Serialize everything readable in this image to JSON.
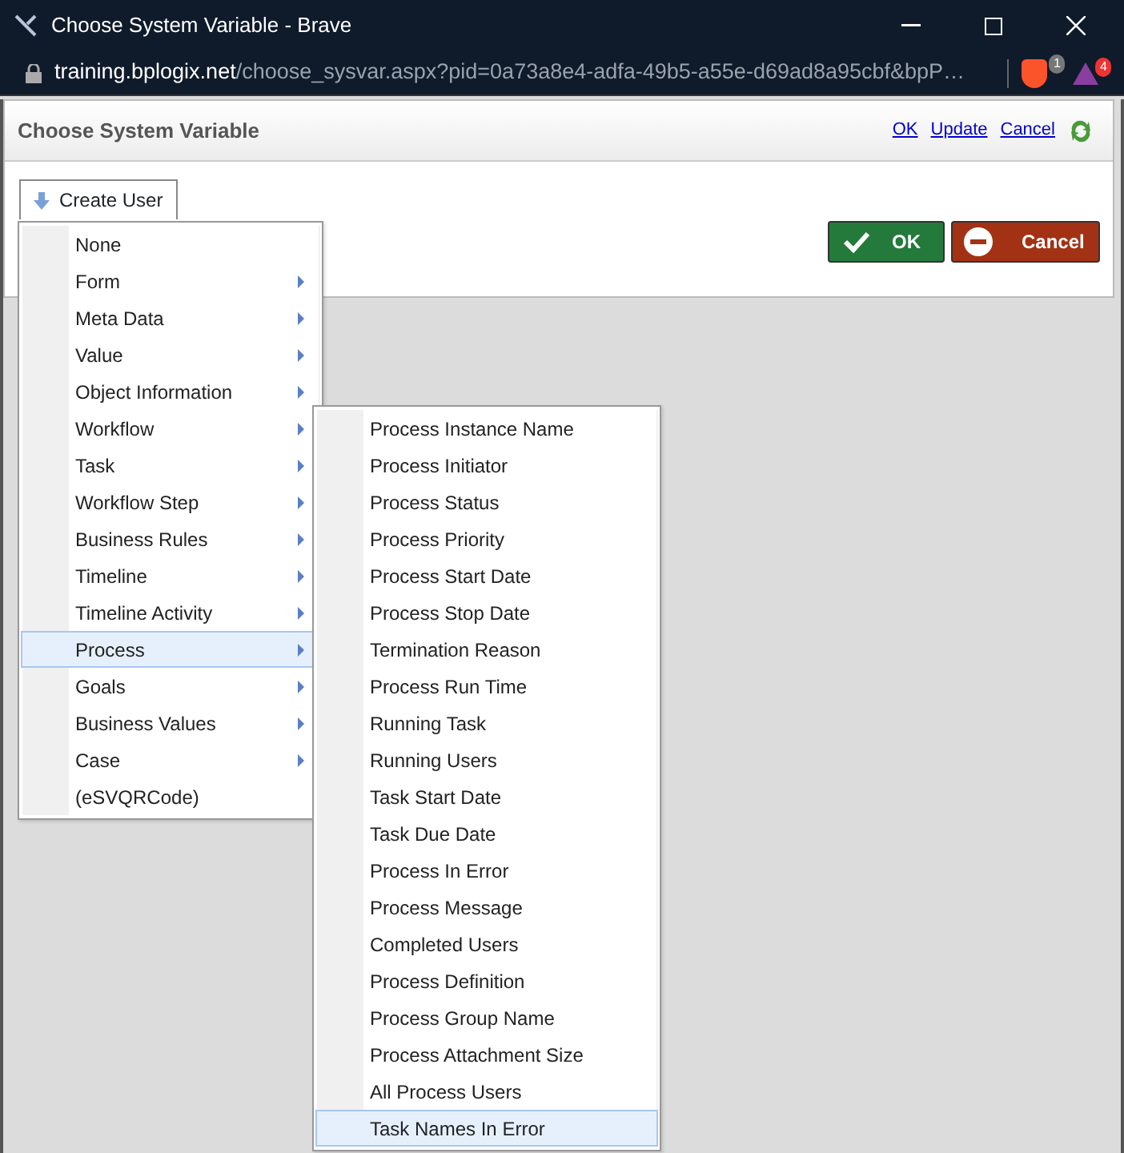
{
  "window": {
    "title": "Choose System Variable - Brave"
  },
  "address": {
    "host": "training.bplogix.net",
    "path": "/choose_sysvar.aspx?pid=0a73a8e4-adfa-49b5-a55e-d69ad8a95cbf&bpP…"
  },
  "extension_badges": [
    "1",
    "4"
  ],
  "panel": {
    "title": "Choose System Variable",
    "links": [
      "OK",
      "Update",
      "Cancel"
    ]
  },
  "dropdown": {
    "label": "Create User"
  },
  "buttons": [
    {
      "label": "OK",
      "kind": "ok"
    },
    {
      "label": "Cancel",
      "kind": "cancel"
    }
  ],
  "menu": [
    {
      "label": "None",
      "submenu": false,
      "selected": false
    },
    {
      "label": "Form",
      "submenu": true,
      "selected": false
    },
    {
      "label": "Meta Data",
      "submenu": true,
      "selected": false
    },
    {
      "label": "Value",
      "submenu": true,
      "selected": false
    },
    {
      "label": "Object Information",
      "submenu": true,
      "selected": false
    },
    {
      "label": "Workflow",
      "submenu": true,
      "selected": false
    },
    {
      "label": "Task",
      "submenu": true,
      "selected": false
    },
    {
      "label": "Workflow Step",
      "submenu": true,
      "selected": false
    },
    {
      "label": "Business Rules",
      "submenu": true,
      "selected": false
    },
    {
      "label": "Timeline",
      "submenu": true,
      "selected": false
    },
    {
      "label": "Timeline Activity",
      "submenu": true,
      "selected": false
    },
    {
      "label": "Process",
      "submenu": true,
      "selected": true
    },
    {
      "label": "Goals",
      "submenu": true,
      "selected": false
    },
    {
      "label": "Business Values",
      "submenu": true,
      "selected": false
    },
    {
      "label": "Case",
      "submenu": true,
      "selected": false
    },
    {
      "label": "(eSVQRCode)",
      "submenu": false,
      "selected": false
    }
  ],
  "submenu": [
    {
      "label": "Process Instance Name",
      "selected": false
    },
    {
      "label": "Process Initiator",
      "selected": false
    },
    {
      "label": "Process Status",
      "selected": false
    },
    {
      "label": "Process Priority",
      "selected": false
    },
    {
      "label": "Process Start Date",
      "selected": false
    },
    {
      "label": "Process Stop Date",
      "selected": false
    },
    {
      "label": "Termination Reason",
      "selected": false
    },
    {
      "label": "Process Run Time",
      "selected": false
    },
    {
      "label": "Running Task",
      "selected": false
    },
    {
      "label": "Running Users",
      "selected": false
    },
    {
      "label": "Task Start Date",
      "selected": false
    },
    {
      "label": "Task Due Date",
      "selected": false
    },
    {
      "label": "Process In Error",
      "selected": false
    },
    {
      "label": "Process Message",
      "selected": false
    },
    {
      "label": "Completed Users",
      "selected": false
    },
    {
      "label": "Process Definition",
      "selected": false
    },
    {
      "label": "Process Group Name",
      "selected": false
    },
    {
      "label": "Process Attachment Size",
      "selected": false
    },
    {
      "label": "All Process Users",
      "selected": false
    },
    {
      "label": "Task Names In Error",
      "selected": true
    }
  ]
}
